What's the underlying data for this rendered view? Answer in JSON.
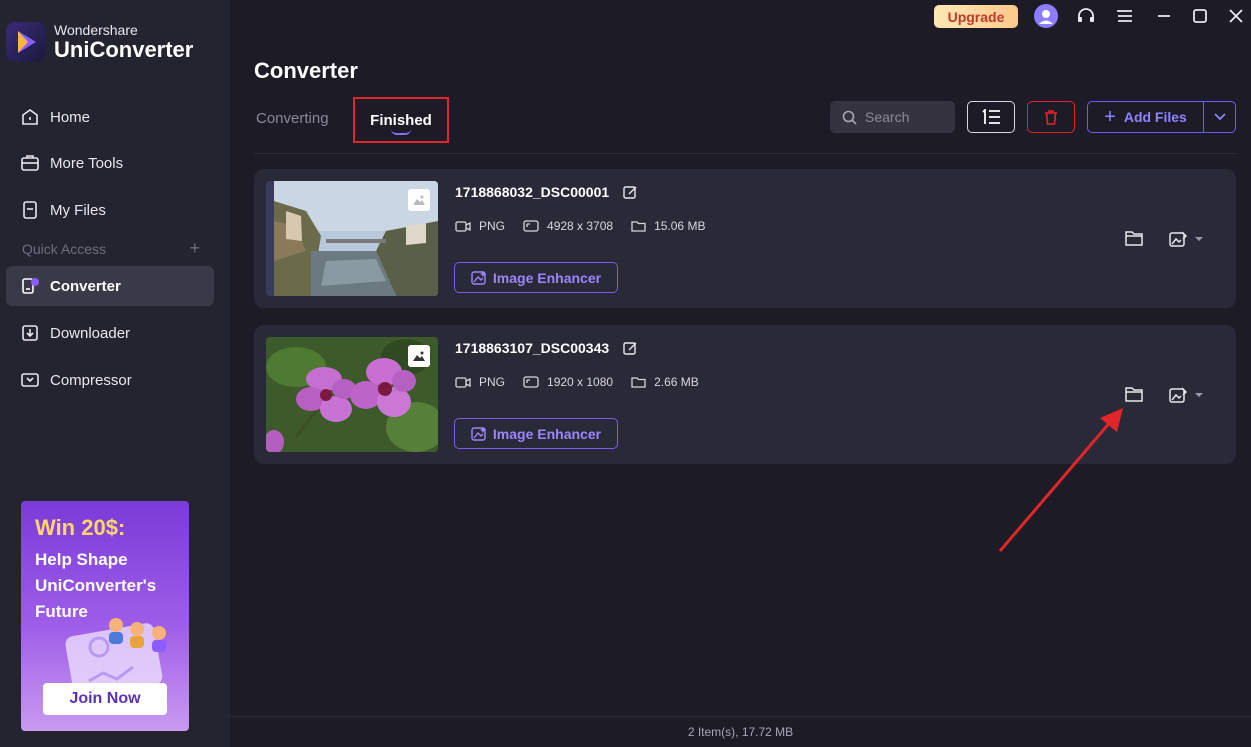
{
  "app": {
    "brand_top": "Wondershare",
    "brand_name": "UniConverter",
    "upgrade_label": "Upgrade"
  },
  "sidebar": {
    "items": [
      {
        "label": "Home",
        "icon": "home-icon"
      },
      {
        "label": "More Tools",
        "icon": "toolbox-icon"
      },
      {
        "label": "My Files",
        "icon": "file-icon"
      },
      {
        "label": "Converter",
        "icon": "converter-icon",
        "active": true
      },
      {
        "label": "Downloader",
        "icon": "download-icon"
      },
      {
        "label": "Compressor",
        "icon": "compress-icon"
      }
    ],
    "quick_access": "Quick Access",
    "quick_access_plus": "+"
  },
  "promo": {
    "title": "Win 20$:",
    "text": "Help Shape UniConverter's Future",
    "button": "Join Now"
  },
  "main": {
    "title": "Converter",
    "tabs": [
      {
        "label": "Converting"
      },
      {
        "label": "Finished",
        "active": true
      }
    ],
    "search_placeholder": "Search",
    "add_files_label": "Add Files"
  },
  "files": [
    {
      "name": "1718868032_DSC00001",
      "format": "PNG",
      "resolution": "4928 x 3708",
      "size": "15.06 MB",
      "enhancer_label": "Image Enhancer"
    },
    {
      "name": "1718863107_DSC00343",
      "format": "PNG",
      "resolution": "1920 x 1080",
      "size": "2.66 MB",
      "enhancer_label": "Image Enhancer"
    }
  ],
  "status": {
    "summary": "2 Item(s), 17.72 MB"
  },
  "colors": {
    "accent": "#6d5cff",
    "highlight_box": "#e0262b",
    "annotation_arrow": "#e0262b"
  }
}
